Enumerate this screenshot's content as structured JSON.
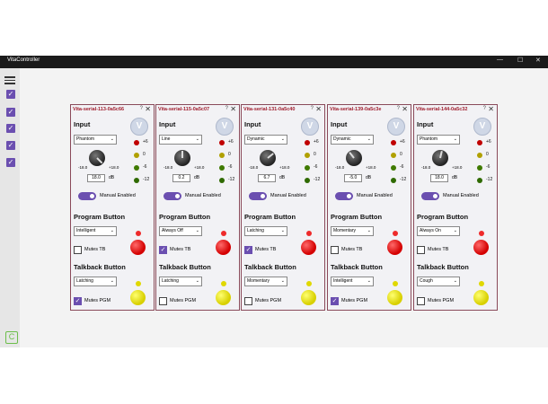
{
  "app": {
    "title": "VitaController"
  },
  "colors": {
    "accent": "#6b4fb0",
    "title_text": "#a01c2c",
    "panel_border": "#8a4a5a"
  },
  "sidebar": {
    "menu_icon": "hamburger-icon",
    "checks": 5,
    "logo_icon": "app-logo-icon"
  },
  "labels": {
    "input": "Input",
    "program_button": "Program Button",
    "talkback_button": "Talkback Button",
    "manual_enabled": "Manual Enabled",
    "mutes_tb": "Mutes TB",
    "mutes_pgm": "Mutes PGM",
    "range_min": "-18.0",
    "range_max": "+18.0",
    "db": "dB",
    "help": "?",
    "close": "✕",
    "meter": [
      "+6",
      "0",
      "-6",
      "-12"
    ],
    "badge": "V"
  },
  "panels": [
    {
      "title": "Vita-serial-113-0a5c66",
      "input_mode": "Phantom",
      "gain": "18.0",
      "gain_fraction": 1.0,
      "program_mode": "Intelligent",
      "mutes_tb": false,
      "talkback_mode": "Latching",
      "mutes_pgm": true
    },
    {
      "title": "Vita-serial-115-0a5c07",
      "input_mode": "Line",
      "gain": "0.2",
      "gain_fraction": 0.5,
      "program_mode": "Always Off",
      "mutes_tb": true,
      "talkback_mode": "Latching",
      "mutes_pgm": false
    },
    {
      "title": "Vita-serial-131-0a5c40",
      "input_mode": "Dynamic",
      "gain": "6.7",
      "gain_fraction": 0.69,
      "program_mode": "Latching",
      "mutes_tb": true,
      "talkback_mode": "Momentary",
      "mutes_pgm": false
    },
    {
      "title": "Vita-serial-139-0a5c3e",
      "input_mode": "Dynamic",
      "gain": "-5.0",
      "gain_fraction": 0.36,
      "program_mode": "Momentary",
      "mutes_tb": false,
      "talkback_mode": "Intelligent",
      "mutes_pgm": true
    },
    {
      "title": "Vita-serial-144-0a5c32",
      "input_mode": "Phantom",
      "gain": "18.0",
      "gain_fraction": 0.55,
      "program_mode": "Always On",
      "mutes_tb": false,
      "talkback_mode": "Cough",
      "mutes_pgm": false
    }
  ]
}
